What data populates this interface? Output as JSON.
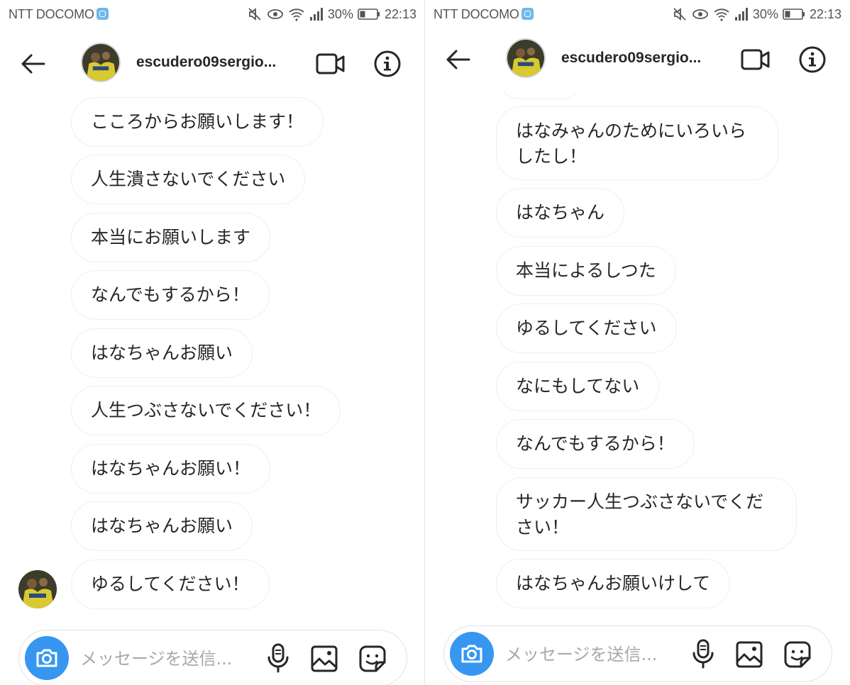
{
  "screens": [
    {
      "status": {
        "carrier": "NTT DOCOMO",
        "battery": "30%",
        "time": "22:13"
      },
      "header": {
        "username": "escudero09sergio..."
      },
      "messages": [
        "こころからお願いします！",
        "人生潰さないでください",
        "本当にお願いします",
        "なんでもするから！",
        "はなちゃんお願い",
        "人生つぶさないでください！",
        "はなちゃんお願い！",
        "はなちゃんお願い",
        "ゆるしてください！"
      ],
      "composer": {
        "placeholder": "メッセージを送信..."
      }
    },
    {
      "status": {
        "carrier": "NTT DOCOMO",
        "battery": "30%",
        "time": "22:13"
      },
      "header": {
        "username": "escudero09sergio..."
      },
      "messages": [
        "",
        "はなみゃんのためにいろいらしたし！",
        "はなちゃん",
        "本当によるしつた",
        "ゆるしてください",
        "なにもしてない",
        "なんでもするから！",
        "サッカー人生つぶさないでください！",
        "はなちゃんお願いけして"
      ],
      "composer": {
        "placeholder": "メッセージを送信..."
      }
    }
  ],
  "icons": {
    "back": "arrow-left-icon",
    "video": "video-camera-icon",
    "info": "info-icon",
    "camera": "camera-icon",
    "mic": "microphone-icon",
    "gallery": "gallery-icon",
    "sticker": "sticker-icon"
  },
  "colors": {
    "accent": "#3797f0",
    "bubble_border": "#efefef",
    "text": "#262626"
  }
}
